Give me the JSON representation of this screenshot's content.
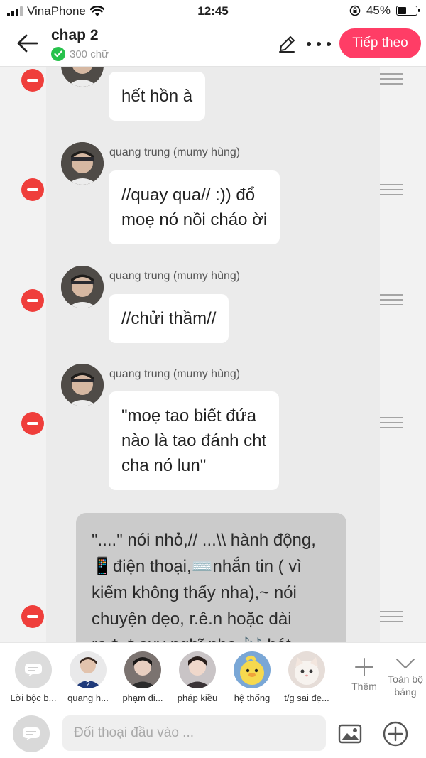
{
  "status_bar": {
    "carrier": "VinaPhone",
    "time": "12:45",
    "battery_percent": "45%",
    "battery_level": 0.45
  },
  "header": {
    "title": "chap 2",
    "word_count": "300 chữ",
    "next_label": "Tiếp theo"
  },
  "messages": [
    {
      "sender": "",
      "text": "hết hồn à"
    },
    {
      "sender": "quang trung (mumy hùng)",
      "text": "//quay qua// :)) đổ\nmoẹ nó nồi cháo ời"
    },
    {
      "sender": "quang trung (mumy hùng)",
      "text": "//chửi thầm//"
    },
    {
      "sender": "quang trung (mumy hùng)",
      "text": "\"moẹ tao biết đứa\nnào là tao đánh cht\ncha nó lun\""
    }
  ],
  "note": {
    "text": "\"....\" nói nhỏ,// ...\\\\ hành động,\n📱điện thoại,⌨️nhắn tin ( vì\nkiếm không thấy nha),~ nói\nchuyện dẹo, r.ê.n hoặc dài\nra *..* suy nghĩ nha 🎶 hát"
  },
  "characters": [
    {
      "name": "Lời bộc b...",
      "kind": "narrator"
    },
    {
      "name": "quang h...",
      "kind": "person"
    },
    {
      "name": "phạm đi...",
      "kind": "person"
    },
    {
      "name": "pháp kiều",
      "kind": "person"
    },
    {
      "name": "hệ thống",
      "kind": "duck"
    },
    {
      "name": "t/g sai đẹ...",
      "kind": "cat"
    }
  ],
  "tools": {
    "add_label": "Thêm",
    "collapse_label": "Toàn bộ bảng"
  },
  "input": {
    "placeholder": "Đối thoại đầu vào ..."
  },
  "colors": {
    "accent": "#ff3d66",
    "delete": "#ef3e3b",
    "check": "#27c24c"
  }
}
